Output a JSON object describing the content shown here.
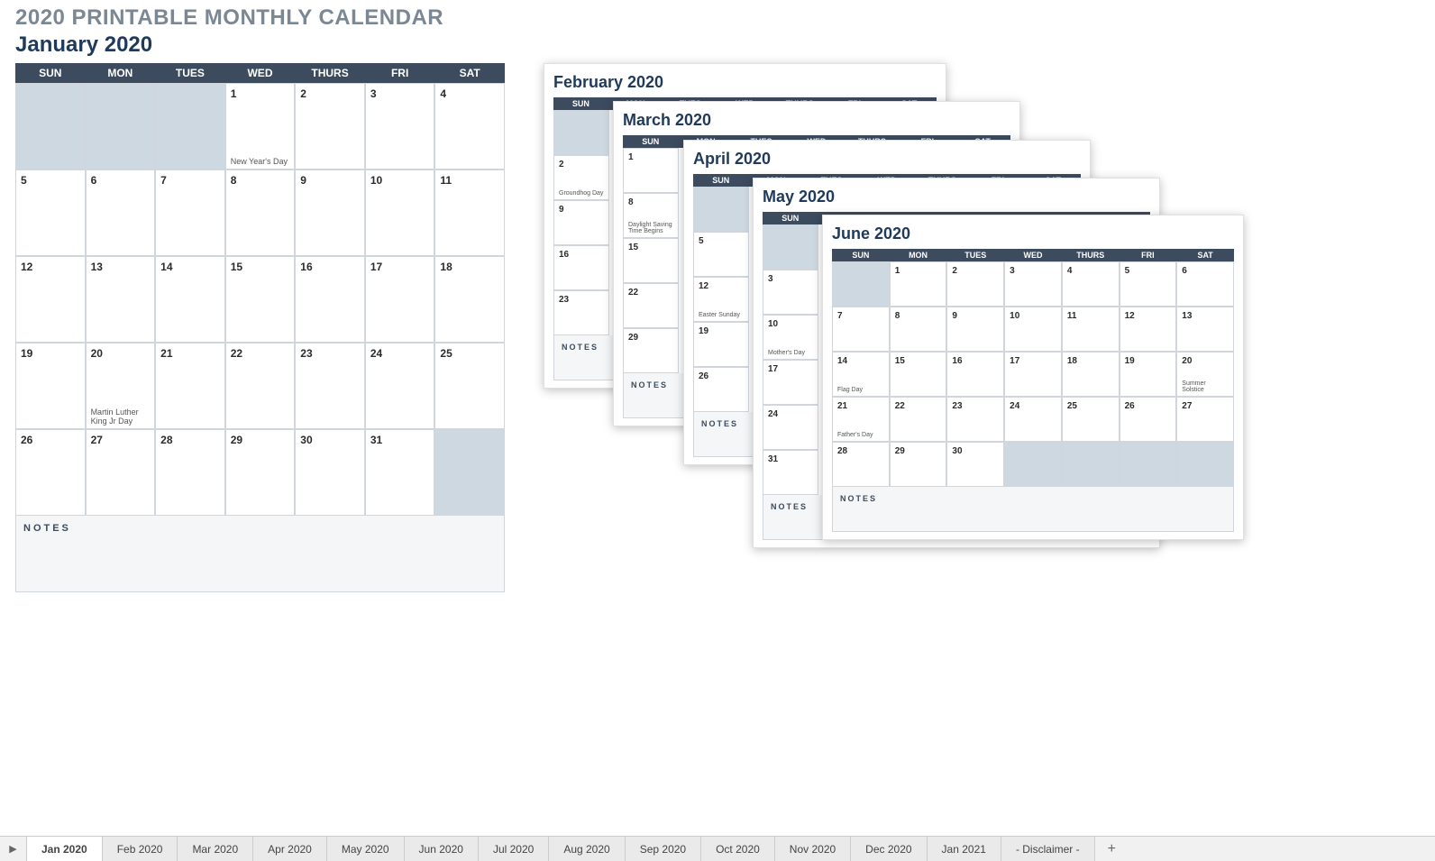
{
  "title": "2020 PRINTABLE MONTHLY CALENDAR",
  "notes_label": "NOTES",
  "days": [
    "SUN",
    "MON",
    "TUES",
    "WED",
    "THURS",
    "FRI",
    "SAT"
  ],
  "main": {
    "month": "January 2020",
    "rows": [
      [
        {
          "n": "",
          "e": ""
        },
        {
          "n": "",
          "e": ""
        },
        {
          "n": "",
          "e": ""
        },
        {
          "n": "1",
          "e": "New Year's Day"
        },
        {
          "n": "2",
          "e": ""
        },
        {
          "n": "3",
          "e": ""
        },
        {
          "n": "4",
          "e": ""
        }
      ],
      [
        {
          "n": "5",
          "e": ""
        },
        {
          "n": "6",
          "e": ""
        },
        {
          "n": "7",
          "e": ""
        },
        {
          "n": "8",
          "e": ""
        },
        {
          "n": "9",
          "e": ""
        },
        {
          "n": "10",
          "e": ""
        },
        {
          "n": "11",
          "e": ""
        }
      ],
      [
        {
          "n": "12",
          "e": ""
        },
        {
          "n": "13",
          "e": ""
        },
        {
          "n": "14",
          "e": ""
        },
        {
          "n": "15",
          "e": ""
        },
        {
          "n": "16",
          "e": ""
        },
        {
          "n": "17",
          "e": ""
        },
        {
          "n": "18",
          "e": ""
        }
      ],
      [
        {
          "n": "19",
          "e": ""
        },
        {
          "n": "20",
          "e": "Martin Luther King Jr Day"
        },
        {
          "n": "21",
          "e": ""
        },
        {
          "n": "22",
          "e": ""
        },
        {
          "n": "23",
          "e": ""
        },
        {
          "n": "24",
          "e": ""
        },
        {
          "n": "25",
          "e": ""
        }
      ],
      [
        {
          "n": "26",
          "e": ""
        },
        {
          "n": "27",
          "e": ""
        },
        {
          "n": "28",
          "e": ""
        },
        {
          "n": "29",
          "e": ""
        },
        {
          "n": "30",
          "e": ""
        },
        {
          "n": "31",
          "e": ""
        },
        {
          "n": "",
          "e": ""
        }
      ]
    ]
  },
  "thumbs": {
    "feb": {
      "month": "February 2020",
      "sun": [
        {
          "n": "",
          "e": ""
        },
        {
          "n": "2",
          "e": "Groundhog Day"
        },
        {
          "n": "9",
          "e": ""
        },
        {
          "n": "16",
          "e": ""
        },
        {
          "n": "23",
          "e": ""
        }
      ]
    },
    "mar": {
      "month": "March 2020",
      "sun": [
        {
          "n": "1",
          "e": ""
        },
        {
          "n": "8",
          "e": "Daylight Saving Time Begins"
        },
        {
          "n": "15",
          "e": ""
        },
        {
          "n": "22",
          "e": ""
        },
        {
          "n": "29",
          "e": ""
        }
      ]
    },
    "apr": {
      "month": "April 2020",
      "sun": [
        {
          "n": "",
          "e": ""
        },
        {
          "n": "5",
          "e": ""
        },
        {
          "n": "12",
          "e": "Easter Sunday"
        },
        {
          "n": "19",
          "e": ""
        },
        {
          "n": "26",
          "e": ""
        }
      ]
    },
    "may": {
      "month": "May 2020",
      "sun": [
        {
          "n": "",
          "e": ""
        },
        {
          "n": "3",
          "e": ""
        },
        {
          "n": "10",
          "e": "Mother's Day"
        },
        {
          "n": "17",
          "e": ""
        },
        {
          "n": "24",
          "e": ""
        },
        {
          "n": "31",
          "e": ""
        }
      ]
    },
    "jun": {
      "month": "June 2020",
      "rows": [
        [
          {
            "n": "",
            "e": ""
          },
          {
            "n": "1",
            "e": ""
          },
          {
            "n": "2",
            "e": ""
          },
          {
            "n": "3",
            "e": ""
          },
          {
            "n": "4",
            "e": ""
          },
          {
            "n": "5",
            "e": ""
          },
          {
            "n": "6",
            "e": ""
          }
        ],
        [
          {
            "n": "7",
            "e": ""
          },
          {
            "n": "8",
            "e": ""
          },
          {
            "n": "9",
            "e": ""
          },
          {
            "n": "10",
            "e": ""
          },
          {
            "n": "11",
            "e": ""
          },
          {
            "n": "12",
            "e": ""
          },
          {
            "n": "13",
            "e": ""
          }
        ],
        [
          {
            "n": "14",
            "e": "Flag Day"
          },
          {
            "n": "15",
            "e": ""
          },
          {
            "n": "16",
            "e": ""
          },
          {
            "n": "17",
            "e": ""
          },
          {
            "n": "18",
            "e": ""
          },
          {
            "n": "19",
            "e": ""
          },
          {
            "n": "20",
            "e": "Summer Solstice"
          }
        ],
        [
          {
            "n": "21",
            "e": "Father's Day"
          },
          {
            "n": "22",
            "e": ""
          },
          {
            "n": "23",
            "e": ""
          },
          {
            "n": "24",
            "e": ""
          },
          {
            "n": "25",
            "e": ""
          },
          {
            "n": "26",
            "e": ""
          },
          {
            "n": "27",
            "e": ""
          }
        ],
        [
          {
            "n": "28",
            "e": ""
          },
          {
            "n": "29",
            "e": ""
          },
          {
            "n": "30",
            "e": ""
          },
          {
            "n": "",
            "e": ""
          },
          {
            "n": "",
            "e": ""
          },
          {
            "n": "",
            "e": ""
          },
          {
            "n": "",
            "e": ""
          }
        ]
      ]
    }
  },
  "tabs": [
    "Jan 2020",
    "Feb 2020",
    "Mar 2020",
    "Apr 2020",
    "May 2020",
    "Jun 2020",
    "Jul 2020",
    "Aug 2020",
    "Sep 2020",
    "Oct 2020",
    "Nov 2020",
    "Dec 2020",
    "Jan 2021",
    "- Disclaimer -"
  ],
  "active_tab": 0
}
